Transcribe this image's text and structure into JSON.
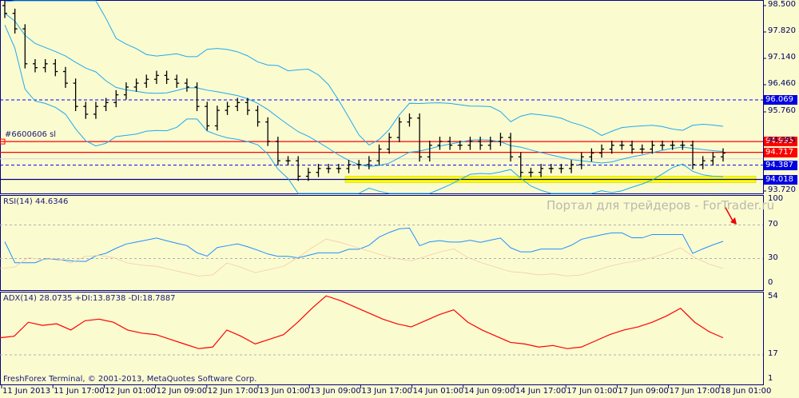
{
  "chart_data": {
    "type": "candlestick",
    "title": "",
    "price_axis": {
      "ylim": [
        93.72,
        98.5
      ],
      "ticks": [
        "98.500",
        "97.820",
        "97.140",
        "96.460",
        "95.760",
        "94.995",
        "93.720"
      ]
    },
    "closes": [
      98.3,
      97.9,
      97.0,
      96.9,
      97.0,
      96.8,
      96.5,
      95.9,
      95.7,
      95.9,
      96.0,
      96.2,
      96.4,
      96.5,
      96.6,
      96.7,
      96.6,
      96.5,
      96.4,
      95.9,
      95.4,
      95.8,
      95.9,
      96.0,
      95.8,
      95.5,
      95.0,
      94.5,
      94.5,
      94.1,
      94.2,
      94.3,
      94.3,
      94.3,
      94.4,
      94.4,
      94.5,
      94.8,
      95.1,
      95.5,
      95.6,
      94.6,
      94.9,
      95.0,
      94.9,
      94.9,
      95.0,
      94.9,
      95.0,
      95.1,
      94.6,
      94.2,
      94.2,
      94.3,
      94.3,
      94.3,
      94.4,
      94.6,
      94.7,
      94.8,
      94.9,
      94.9,
      94.8,
      94.8,
      94.9,
      94.9,
      94.9,
      94.9,
      94.4,
      94.5,
      94.6,
      94.7
    ],
    "levels": [
      {
        "value": 96.069,
        "label": "96.069",
        "color": "#0000ff",
        "style": "dashed"
      },
      {
        "value": 94.995,
        "label": "94.995",
        "color": "#ff0000",
        "style": "solid"
      },
      {
        "value": 94.717,
        "label": "94.717",
        "color": "#ff0000",
        "style": "solid"
      },
      {
        "value": 94.387,
        "label": "94.387",
        "color": "#0000ff",
        "style": "dashed"
      },
      {
        "value": 94.018,
        "label": "94.018",
        "color": "#000080",
        "style": "solid"
      }
    ],
    "order_label": "#6600606 sl",
    "rsi": {
      "label": "RSI(14) 44.6346",
      "ylim": [
        0,
        100
      ],
      "ticks": [
        "100",
        "70",
        "30",
        "0"
      ],
      "levels": [
        70,
        30
      ]
    },
    "adx": {
      "label": "ADX(14) 28.0735 +DI:13.8738 -DI:18.7887",
      "ylim": [
        1,
        54
      ],
      "ticks": [
        "54",
        "17",
        "1"
      ],
      "level": 17,
      "values": [
        28,
        29,
        38,
        36,
        37,
        33,
        39,
        40,
        38,
        33,
        31,
        30,
        27,
        24,
        21,
        22,
        33,
        29,
        24,
        27,
        30,
        38,
        47,
        55,
        52,
        48,
        44,
        40,
        37,
        35,
        39,
        43,
        46,
        38,
        33,
        29,
        25,
        24,
        22,
        23,
        21,
        22,
        26,
        30,
        33,
        35,
        38,
        42,
        47,
        38,
        32,
        28
      ]
    },
    "time_ticks": [
      "11 Jun 2013",
      "11 Jun 17:00",
      "12 Jun 01:00",
      "12 Jun 09:00",
      "12 Jun 17:00",
      "13 Jun 01:00",
      "13 Jun 09:00",
      "13 Jun 17:00",
      "14 Jun 01:00",
      "14 Jun 09:00",
      "14 Jun 17:00",
      "17 Jun 01:00",
      "17 Jun 09:00",
      "17 Jun 17:00",
      "18 Jun 01:00"
    ]
  },
  "footer": "FreshForex Terminal, © 2001-2013, MetaQuotes Software Corp.",
  "watermark": "Портал для трейдеров - ForTrader.ru",
  "colors": {
    "background": "#fbfbd0",
    "frame": "#000080",
    "bands": "#1eaaf0",
    "rsi": "#1e90ff",
    "adx": "#ff0000",
    "highlight": "#ffff00"
  }
}
